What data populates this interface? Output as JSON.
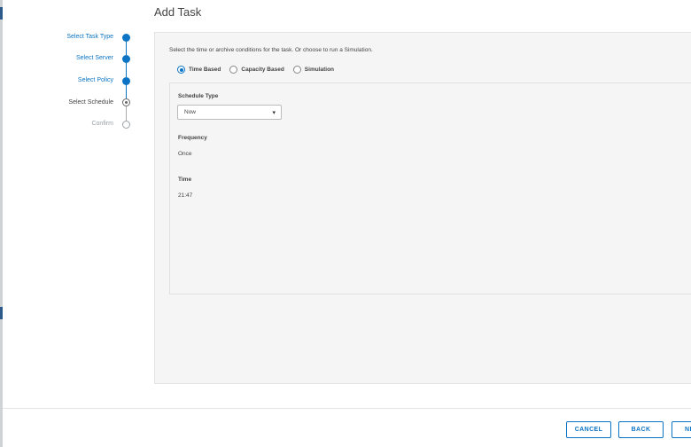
{
  "title": "Add Task",
  "steps": [
    {
      "label": "Select Task Type",
      "state": "done"
    },
    {
      "label": "Select Server",
      "state": "done"
    },
    {
      "label": "Select Policy",
      "state": "done"
    },
    {
      "label": "Select Schedule",
      "state": "current"
    },
    {
      "label": "Confirm",
      "state": "todo"
    }
  ],
  "instructions": "Select the time or archive conditions for the task. Or choose to run a Simulation.",
  "radio_options": [
    {
      "label": "Time Based",
      "checked": true
    },
    {
      "label": "Capacity Based",
      "checked": false
    },
    {
      "label": "Simulation",
      "checked": false
    }
  ],
  "schedule": {
    "type_label": "Schedule Type",
    "type_value": "Now",
    "frequency_label": "Frequency",
    "frequency_value": "Once",
    "time_label": "Time",
    "time_value": "21:47"
  },
  "buttons": {
    "cancel": "CANCEL",
    "back": "BACK",
    "next": "NEXT"
  },
  "colors": {
    "accent": "#0b74c4"
  }
}
